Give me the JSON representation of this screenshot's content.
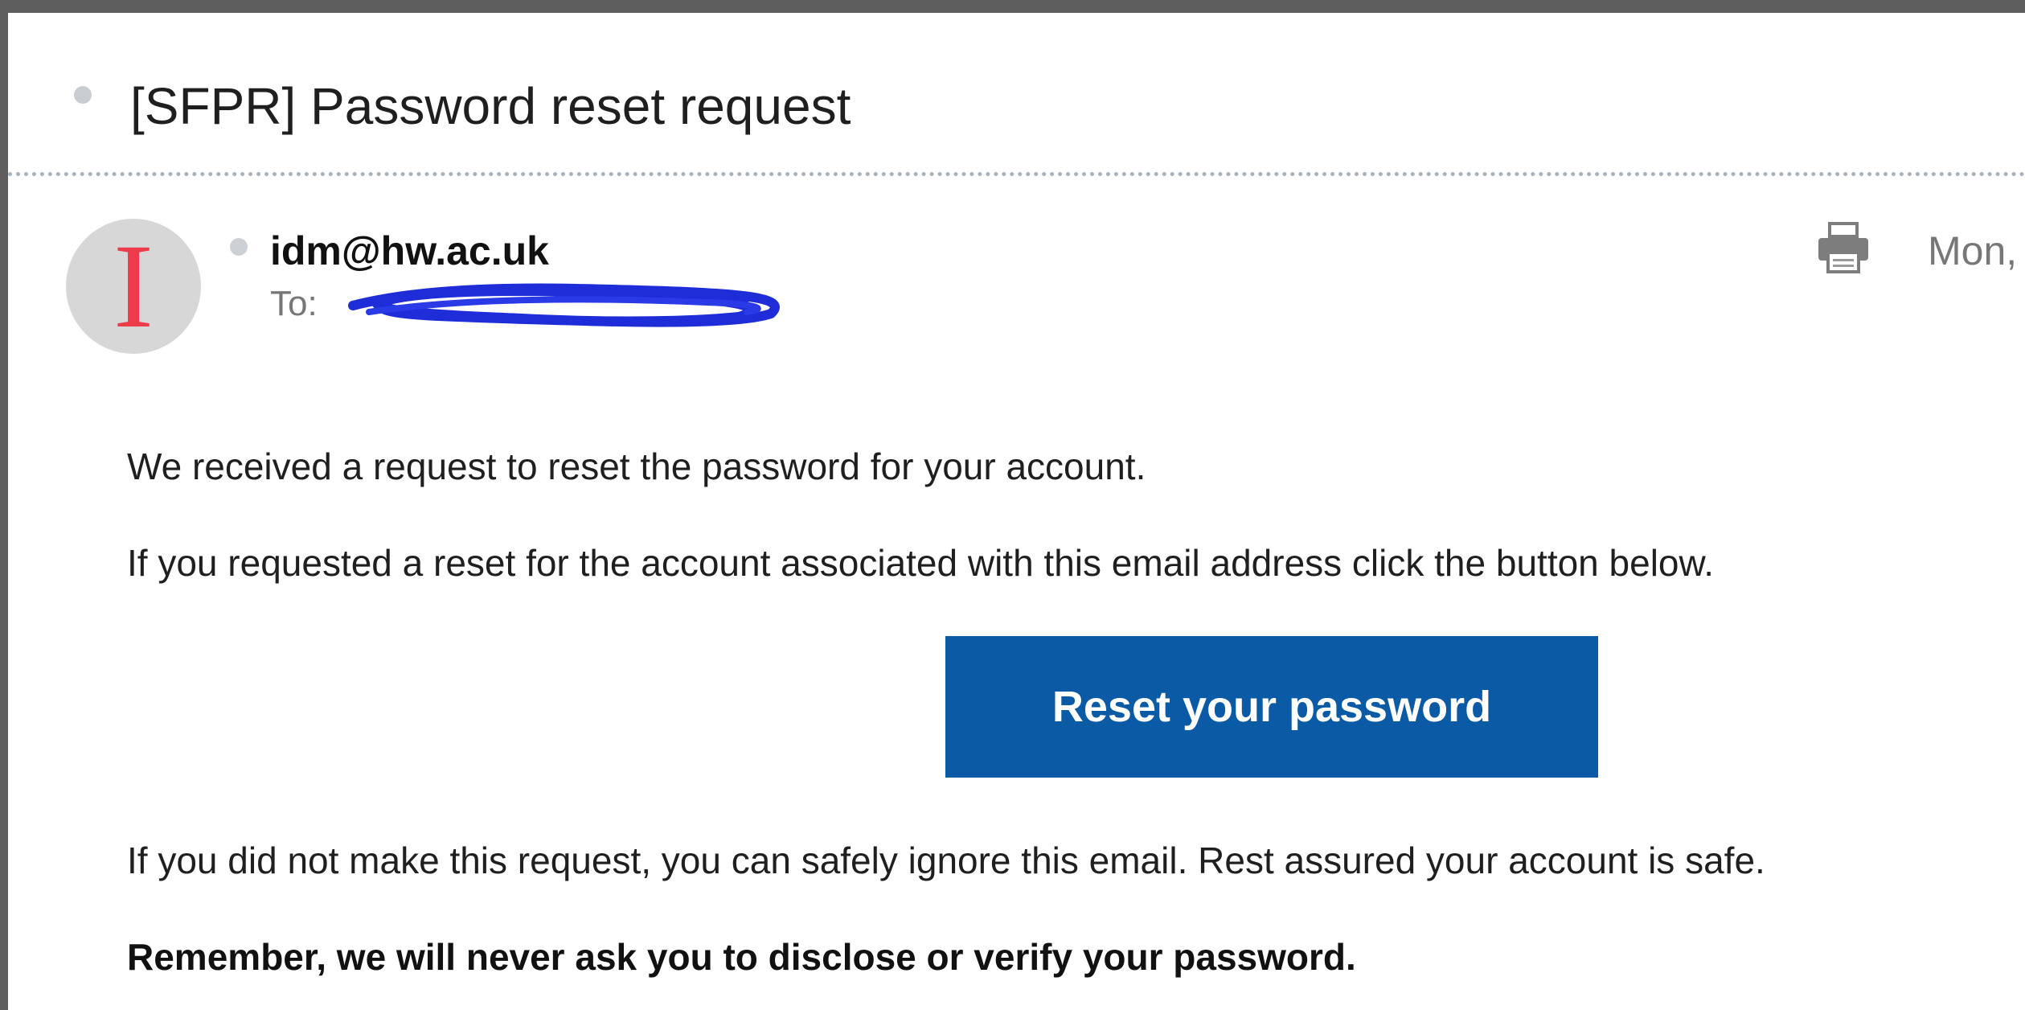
{
  "email": {
    "subject": "[SFPR] Password reset request",
    "avatar_letter": "I",
    "sender": "idm@hw.ac.uk",
    "to_label": "To:",
    "date": "Mon,",
    "print_icon": "printer-icon",
    "body": {
      "line1": "We received a request to reset the password for your account.",
      "line2": "If you requested a reset for the account associated with this email address click the button below.",
      "button_label": "Reset your password",
      "line3": "If you did not make this request, you can safely ignore this email. Rest assured your account is safe.",
      "line4": "Remember, we will never ask you to disclose or verify your password."
    }
  },
  "colors": {
    "button_blue": "#0b5aa6",
    "avatar_red": "#ee3b4b",
    "redaction_blue": "#1e2dd8",
    "subject_divider": "#a8b2bc"
  }
}
